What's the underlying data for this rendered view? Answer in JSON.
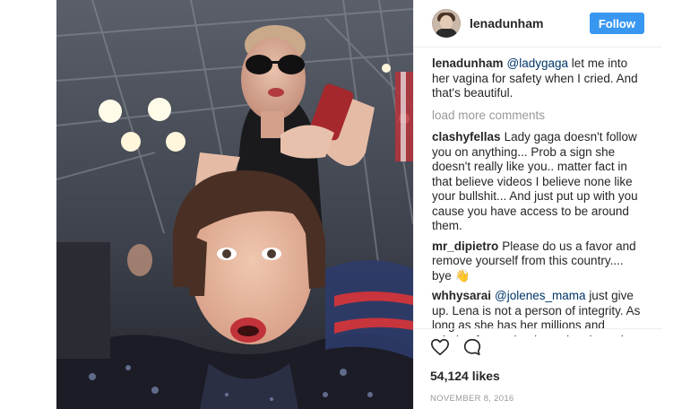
{
  "post": {
    "username": "lenadunham",
    "follow_label": "Follow",
    "caption": {
      "user": "lenadunham",
      "mention": "@ladygaga",
      "text": "let me into her vagina for safety when I cried. And that's beautiful."
    },
    "load_more": "load more comments",
    "comments": [
      {
        "user": "clashyfellas",
        "mention": "",
        "text": "Lady gaga doesn't follow you on anything... Prob a sign she doesn't really like you.. matter fact in that believe videos I believe none like your bullshit... And just put up with you cause you have access to be around them."
      },
      {
        "user": "mr_dipietro",
        "mention": "",
        "text": "Please do us a favor and remove yourself from this country.... bye 👋"
      },
      {
        "user": "whhysarai",
        "mention": "@jolenes_mama",
        "text": "just give up. Lena is not a person of integrity. As long as she has her millions and adoring fans, what incentive does she have to be honest? She will never get what she deserves and she'll surround herself with much worse offenders and violators of children like Joe"
      }
    ],
    "likes": "54,124 likes",
    "date": "NOVEMBER 8, 2016",
    "icons": {
      "like": "heart-icon",
      "comment": "comment-icon"
    }
  },
  "colors": {
    "follow_button": "#3897f0",
    "mention": "#003569",
    "muted": "#999999",
    "text": "#262626"
  }
}
